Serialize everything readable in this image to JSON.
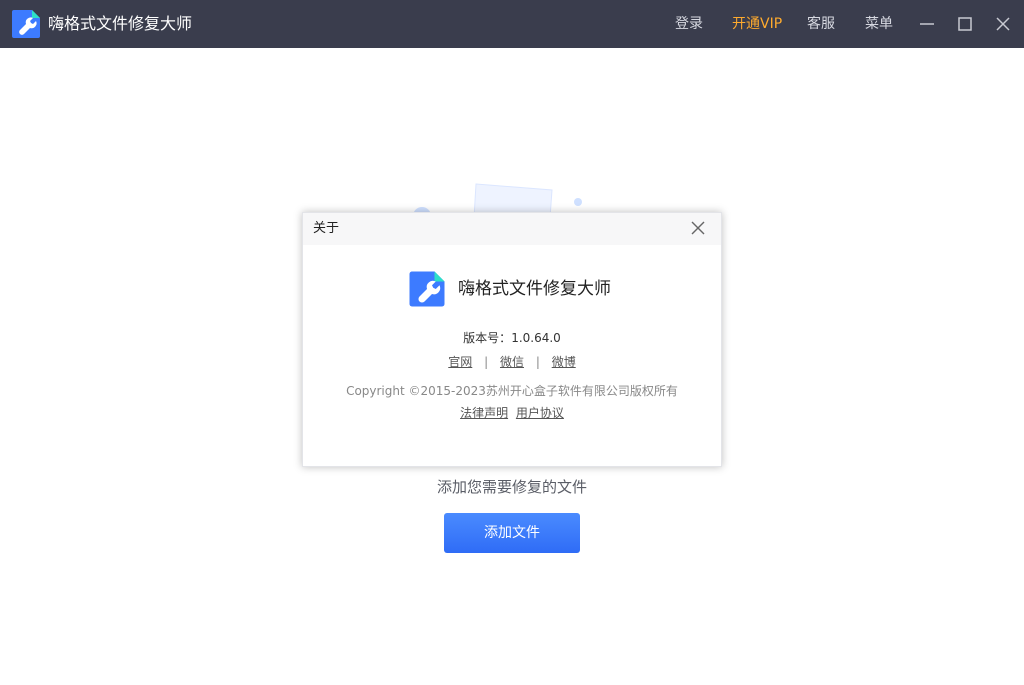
{
  "app": {
    "title": "嗨格式文件修复大师",
    "logo_icon": "wrench-document-icon",
    "brand_color": "#2f6cf6",
    "accent_color": "#2de0c8"
  },
  "titlebar": {
    "nav": {
      "login": "登录",
      "vip": "开通VIP",
      "service": "客服",
      "menu": "菜单"
    },
    "vip_color": "#ffab2e",
    "window_icons": [
      "minimize-icon",
      "maximize-icon",
      "close-icon"
    ]
  },
  "main": {
    "prompt": "添加您需要修复的文件",
    "add_button": "添加文件"
  },
  "about_dialog": {
    "title": "关于",
    "app_name": "嗨格式文件修复大师",
    "version_label": "版本号：",
    "version": "1.0.64.0",
    "links": [
      "官网",
      "微信",
      "微博"
    ],
    "link_separator": "|",
    "copyright": "Copyright ©2015-2023苏州开心盒子软件有限公司版权所有",
    "legal_links": [
      "法律声明",
      "用户协议"
    ]
  }
}
